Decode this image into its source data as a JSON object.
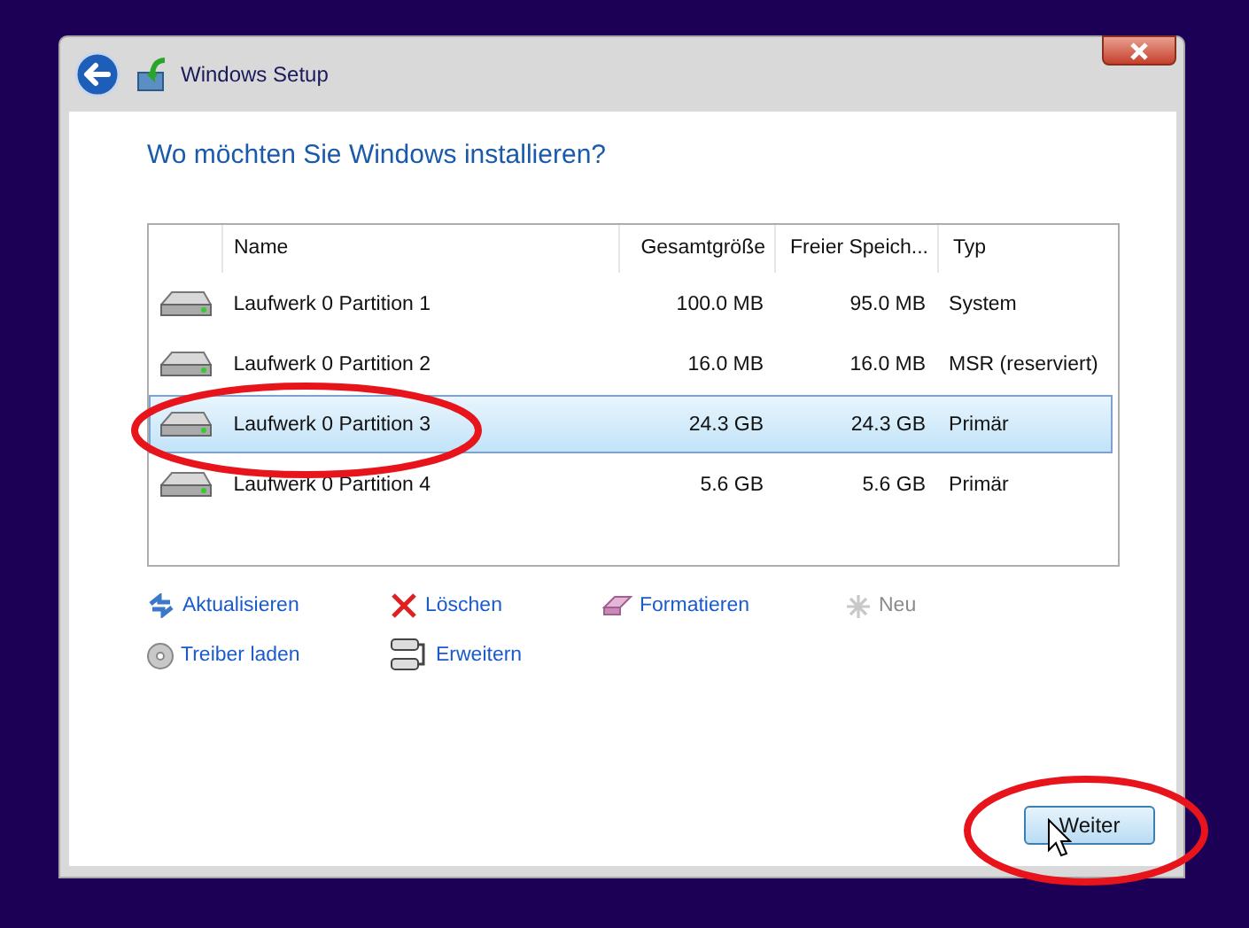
{
  "window": {
    "title": "Windows Setup"
  },
  "heading": "Wo möchten Sie Windows installieren?",
  "table": {
    "columns": [
      "Name",
      "Gesamtgröße",
      "Freier Speich...",
      "Typ"
    ],
    "rows": [
      {
        "name": "Laufwerk 0 Partition 1",
        "total": "100.0 MB",
        "free": "95.0 MB",
        "type": "System",
        "selected": false
      },
      {
        "name": "Laufwerk 0 Partition 2",
        "total": "16.0 MB",
        "free": "16.0 MB",
        "type": "MSR (reserviert)",
        "selected": false
      },
      {
        "name": "Laufwerk 0 Partition 3",
        "total": "24.3 GB",
        "free": "24.3 GB",
        "type": "Primär",
        "selected": true
      },
      {
        "name": "Laufwerk 0 Partition 4",
        "total": "5.6 GB",
        "free": "5.6 GB",
        "type": "Primär",
        "selected": false
      }
    ]
  },
  "actions": [
    {
      "kind": "refresh",
      "label": "Aktualisieren",
      "disabled": false
    },
    {
      "kind": "delete",
      "label": "Löschen",
      "disabled": false
    },
    {
      "kind": "format",
      "label": "Formatieren",
      "disabled": false
    },
    {
      "kind": "new",
      "label": "Neu",
      "disabled": true
    },
    {
      "kind": "driver",
      "label": "Treiber laden",
      "disabled": false
    },
    {
      "kind": "extend",
      "label": "Erweitern",
      "disabled": false
    }
  ],
  "next_button": "Weiter"
}
